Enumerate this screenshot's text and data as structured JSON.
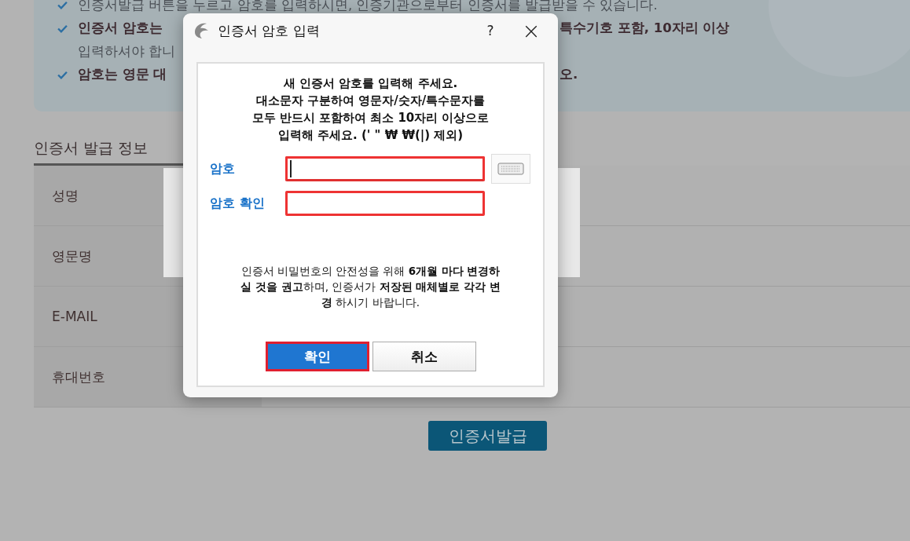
{
  "info_box": {
    "lines": [
      {
        "left": "인증서발급 버튼을 누르고 암호를 입력하시면, 인증기관으로부터 인증서를 발급받을 수 있습니다.",
        "bold": false,
        "bullet": true
      },
      {
        "left": "인증서 암호는",
        "right": "특수기호 포함, 10자리 이상",
        "bold": true,
        "bullet": true
      },
      {
        "left": "입력하셔야 합니",
        "bold": false,
        "bullet": false
      },
      {
        "left": "암호는 영문 대",
        "right": "오.",
        "bold": true,
        "bullet": true
      }
    ]
  },
  "section_title": "인증서 발급 정보",
  "table": {
    "rows": [
      {
        "label": "성명"
      },
      {
        "label": "영문명"
      },
      {
        "label": "E-MAIL"
      },
      {
        "label": "휴대번호"
      }
    ]
  },
  "issue_button": "인증서발급",
  "dialog": {
    "title": "인증서 암호 입력",
    "help": "?",
    "close": "×",
    "heading": [
      "새 인증서 암호를 입력해 주세요.",
      "대소문자 구분하여 영문자/숫자/특수문자를",
      "모두 반드시 포함하여 최소 10자리 이상으로",
      "입력해 주세요. (' \" ₩ ₩(|) 제외)"
    ],
    "fields": [
      {
        "label": "암호",
        "focused": true,
        "keyboard": true
      },
      {
        "label": "암호 확인",
        "focused": false,
        "keyboard": false
      }
    ],
    "notice": "인증서 비밀번호의 안전성을 위해 **6개월 마다 변경하실 것을 권고**하며, 인증서가 **저장된 매체별로 각각 변경** 하시기 바랍니다.",
    "buttons": [
      {
        "label": "확인",
        "selected": true
      },
      {
        "label": "취소",
        "selected": false
      }
    ]
  }
}
